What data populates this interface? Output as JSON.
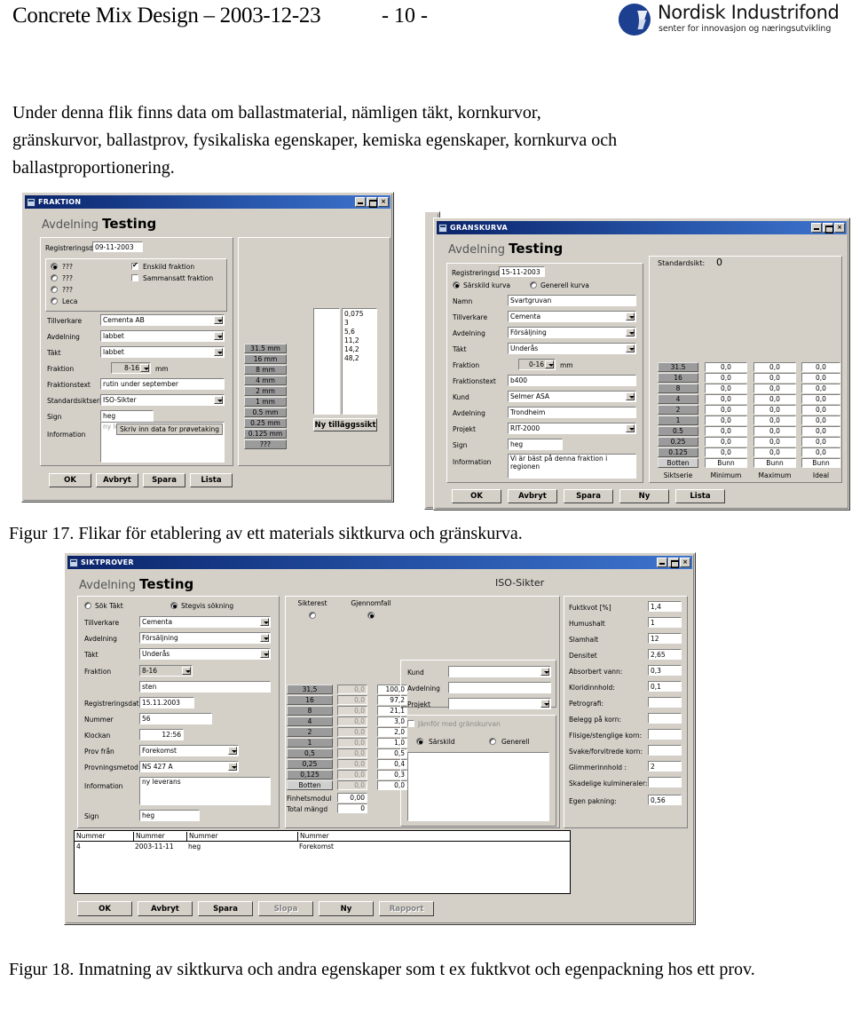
{
  "header": {
    "doc_title": "Concrete Mix Design – 2003-12-23",
    "page_number": "- 10 -",
    "logo_name": "Nordisk Industrifond",
    "logo_tagline": "senter for innovasjon og næringsutvikling",
    "logo_color": "#1c3f8f"
  },
  "body": {
    "paragraph": "Under denna flik finns data om ballastmaterial, nämligen täkt, kornkurvor, gränskurvor, ballastprov, fysikaliska egenskaper, kemiska egenskaper, kornkurva och ballastproportionering.",
    "caption_17": "Figur 17. Flikar för etablering av ett materials siktkurva och gränskurva.",
    "caption_18": "Figur 18. Inmatning av siktkurva och andra egenskaper som t ex fuktkvot och egenpackning hos ett prov."
  },
  "fraktion_window": {
    "title": "FRAKTION",
    "buttons": {
      "minimize": "_",
      "maximize": "□",
      "close": "×"
    },
    "dept_label": "Avdelning",
    "dept_value": "Testing",
    "reg_label": "Registreringsdatum",
    "reg_value": "09-11-2003",
    "radios": [
      {
        "label": "???",
        "selected": true
      },
      {
        "label": "???",
        "selected": false
      },
      {
        "label": "???",
        "selected": false
      },
      {
        "label": "Leca",
        "selected": false
      }
    ],
    "checks": [
      {
        "label": "Enskild fraktion",
        "checked": true
      },
      {
        "label": "Sammansatt fraktion",
        "checked": false
      }
    ],
    "fields": [
      {
        "label": "Tillverkare",
        "value": "Cementa AB",
        "type": "combo"
      },
      {
        "label": "Avdelning",
        "value": "labbet",
        "type": "combo"
      },
      {
        "label": "Täkt",
        "value": "labbet",
        "type": "combo"
      },
      {
        "label": "Fraktion",
        "value": "8-16",
        "type": "combo-small",
        "unit": "mm"
      },
      {
        "label": "Fraktionstext",
        "value": "rutin under september",
        "type": "text"
      },
      {
        "label": "Standardsiktserie",
        "value": "ISO-Sikter",
        "type": "combo"
      },
      {
        "label": "Sign",
        "value": "heg",
        "type": "text"
      },
      {
        "label": "Information",
        "value": "ny leverans i september",
        "type": "textarea"
      }
    ],
    "tooltip": "Skriv inn data for prøvetaking",
    "sieves": [
      "31.5 mm",
      "16 mm",
      "8 mm",
      "4 mm",
      "2 mm",
      "1 mm",
      "0.5 mm",
      "0.25 mm",
      "0.125 mm",
      "???"
    ],
    "extra_values": [
      "0,075",
      "3",
      "5,6",
      "11,2",
      "14,2",
      "48,2"
    ],
    "extra_button": "Ny tilläggssikt",
    "footer_buttons": [
      "OK",
      "Avbryt",
      "Spara",
      "Lista"
    ]
  },
  "granskurva_window": {
    "title": "GRÄNSKURVA",
    "buttons": {
      "minimize": "_",
      "maximize": "□",
      "close": "×"
    },
    "dept_label": "Avdelning",
    "dept_value": "Testing",
    "reg_label": "Registreringsdatum",
    "reg_value": "15-11-2003",
    "radios": [
      {
        "label": "Särskild kurva",
        "selected": true
      },
      {
        "label": "Generell kurva",
        "selected": false
      }
    ],
    "fields": [
      {
        "label": "Namn",
        "value": "Svartgruvan",
        "type": "text"
      },
      {
        "label": "Tillverkare",
        "value": "Cementa",
        "type": "combo"
      },
      {
        "label": "Avdelning",
        "value": "Försäljning",
        "type": "combo"
      },
      {
        "label": "Täkt",
        "value": "Underås",
        "type": "combo"
      },
      {
        "label": "Fraktion",
        "value": "0-16",
        "type": "combo-small",
        "unit": "mm"
      },
      {
        "label": "Fraktionstext",
        "value": "b400",
        "type": "text"
      },
      {
        "label": "Kund",
        "value": "Selmer ASA",
        "type": "combo"
      },
      {
        "label": "Avdelning",
        "value": "Trondheim",
        "type": "text"
      },
      {
        "label": "Projekt",
        "value": "RIT-2000",
        "type": "combo"
      },
      {
        "label": "Sign",
        "value": "heg",
        "type": "text"
      },
      {
        "label": "Information",
        "value": "Vi är bäst på denna fraktion i regionen",
        "type": "textarea"
      }
    ],
    "standard_sieve_label": "Standardsikt:",
    "standard_sieve_value": "0",
    "table": {
      "columns": [
        "Siktserie",
        "Minimum",
        "Maximum",
        "Ideal"
      ],
      "rows": [
        {
          "sieve": "31.5",
          "minimum": "0,0",
          "maximum": "0,0",
          "ideal": "0,0"
        },
        {
          "sieve": "16",
          "minimum": "0,0",
          "maximum": "0,0",
          "ideal": "0,0"
        },
        {
          "sieve": "8",
          "minimum": "0,0",
          "maximum": "0,0",
          "ideal": "0,0"
        },
        {
          "sieve": "4",
          "minimum": "0,0",
          "maximum": "0,0",
          "ideal": "0,0"
        },
        {
          "sieve": "2",
          "minimum": "0,0",
          "maximum": "0,0",
          "ideal": "0,0"
        },
        {
          "sieve": "1",
          "minimum": "0,0",
          "maximum": "0,0",
          "ideal": "0,0"
        },
        {
          "sieve": "0.5",
          "minimum": "0,0",
          "maximum": "0,0",
          "ideal": "0,0"
        },
        {
          "sieve": "0.25",
          "minimum": "0,0",
          "maximum": "0,0",
          "ideal": "0,0"
        },
        {
          "sieve": "0.125",
          "minimum": "0,0",
          "maximum": "0,0",
          "ideal": "0,0"
        },
        {
          "sieve": "Botten",
          "minimum": "Bunn",
          "maximum": "Bunn",
          "ideal": "Bunn"
        }
      ]
    },
    "footer_buttons": [
      "OK",
      "Avbryt",
      "Spara",
      "Ny",
      "Lista"
    ]
  },
  "siktprover_window": {
    "title": "SIKTPROVER",
    "buttons": {
      "minimize": "_",
      "maximize": "□",
      "close": "×"
    },
    "dept_label": "Avdelning",
    "dept_value": "Testing",
    "iso_title": "ISO-Sikter",
    "search_radios": [
      {
        "label": "Sök Täkt",
        "selected": false
      },
      {
        "label": "Stegvis sökning",
        "selected": true
      }
    ],
    "fields": [
      {
        "label": "Tillverkare",
        "value": "Cementa",
        "type": "combo"
      },
      {
        "label": "Avdelning",
        "value": "Försäljning",
        "type": "combo"
      },
      {
        "label": "Täkt",
        "value": "Underås",
        "type": "combo"
      },
      {
        "label": "Fraktion",
        "value": "8-16",
        "type": "combo-small"
      },
      {
        "label": "",
        "value": "sten",
        "type": "text"
      },
      {
        "label": "Registreringsdatum",
        "value": "15.11.2003",
        "type": "text"
      },
      {
        "label": "Nummer",
        "value": "56",
        "type": "text"
      },
      {
        "label": "Klockan",
        "value": "12:56",
        "type": "text"
      },
      {
        "label": "Prov från",
        "value": "Forekomst",
        "type": "combo"
      },
      {
        "label": "Provningsmetod",
        "value": "NS 427 A",
        "type": "combo"
      },
      {
        "label": "Information",
        "value": "ny leverans",
        "type": "textarea"
      },
      {
        "label": "Sign",
        "value": "heg",
        "type": "text"
      }
    ],
    "mode_radios": [
      {
        "label": "Sikterest",
        "selected": false
      },
      {
        "label": "Gjennomfall",
        "selected": true
      }
    ],
    "sieve_table": {
      "rows": [
        {
          "sieve": "31,5",
          "sikterest": "0,0",
          "gjennomfall": "100,0"
        },
        {
          "sieve": "16",
          "sikterest": "0,0",
          "gjennomfall": "97,2"
        },
        {
          "sieve": "8",
          "sikterest": "0,0",
          "gjennomfall": "21,1"
        },
        {
          "sieve": "4",
          "sikterest": "0,0",
          "gjennomfall": "3,0"
        },
        {
          "sieve": "2",
          "sikterest": "0,0",
          "gjennomfall": "2,0"
        },
        {
          "sieve": "1",
          "sikterest": "0,0",
          "gjennomfall": "1,0"
        },
        {
          "sieve": "0,5",
          "sikterest": "0,0",
          "gjennomfall": "0,5"
        },
        {
          "sieve": "0,25",
          "sikterest": "0,0",
          "gjennomfall": "0,4"
        },
        {
          "sieve": "0,125",
          "sikterest": "0,0",
          "gjennomfall": "0,3"
        },
        {
          "sieve": "Botten",
          "sikterest": "0,0",
          "gjennomfall": "0,0"
        }
      ],
      "fineness_label": "Finhetsmodul",
      "fineness_value": "0,00",
      "total_label": "Total mängd",
      "total_value": "0"
    },
    "customer_fields": [
      {
        "label": "Kund",
        "value": "",
        "type": "combo"
      },
      {
        "label": "Avdelning",
        "value": "",
        "type": "text"
      },
      {
        "label": "Projekt",
        "value": "",
        "type": "combo"
      }
    ],
    "compare_check": {
      "label": "Jämför med gränskurvan",
      "checked": false
    },
    "curve_radios": [
      {
        "label": "Särskild",
        "selected": true
      },
      {
        "label": "Generell",
        "selected": false
      }
    ],
    "properties": [
      {
        "label": "Fuktkvot [%]",
        "value": "1,4"
      },
      {
        "label": "Humushalt",
        "value": "1"
      },
      {
        "label": "Slamhalt",
        "value": "12"
      },
      {
        "label": "Densitet",
        "value": "2,65"
      },
      {
        "label": "Absorbert vann:",
        "value": "0,3"
      },
      {
        "label": "Kloridinnhold:",
        "value": "0,1"
      },
      {
        "label": "Petrografi:",
        "value": ""
      },
      {
        "label": "Belegg på korn:",
        "value": ""
      },
      {
        "label": "Flisige/stenglige korn:",
        "value": ""
      },
      {
        "label": "Svake/forvitrede korn:",
        "value": ""
      },
      {
        "label": "Glimmerinnhold :",
        "value": "2"
      },
      {
        "label": "Skadelige kulmineraler:",
        "value": ""
      },
      {
        "label": "Egen pakning:",
        "value": "0,56"
      }
    ],
    "grid": {
      "columns": [
        "Nummer",
        "Nummer",
        "Nummer",
        "Nummer"
      ],
      "rows": [
        [
          "4",
          "2003-11-11",
          "heg",
          "Forekomst"
        ]
      ]
    },
    "footer_buttons": [
      {
        "label": "OK",
        "enabled": true
      },
      {
        "label": "Avbryt",
        "enabled": true
      },
      {
        "label": "Spara",
        "enabled": true
      },
      {
        "label": "Slopa",
        "enabled": false
      },
      {
        "label": "Ny",
        "enabled": true
      },
      {
        "label": "Rapport",
        "enabled": false
      }
    ]
  }
}
